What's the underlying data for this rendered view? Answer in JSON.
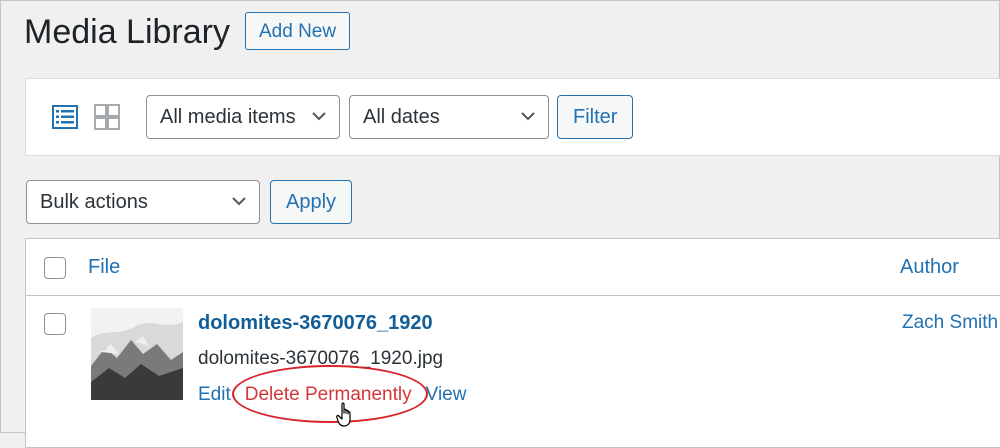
{
  "header": {
    "title": "Media Library",
    "add_new_label": "Add New"
  },
  "filter_bar": {
    "view_icons": [
      "list-view-icon",
      "grid-view-icon"
    ],
    "media_type_select": {
      "selected": "All media items"
    },
    "date_select": {
      "selected": "All dates"
    },
    "filter_label": "Filter"
  },
  "bulk": {
    "select": {
      "selected": "Bulk actions"
    },
    "apply_label": "Apply"
  },
  "table": {
    "columns": [
      "File",
      "Author"
    ],
    "rows": [
      {
        "title": "dolomites-3670076_1920",
        "filename": "dolomites-3670076_1920.jpg",
        "author": "Zach Smith",
        "actions": {
          "edit": "Edit",
          "delete": "Delete Permanently",
          "view": "View"
        }
      }
    ]
  },
  "colors": {
    "accent": "#2271b1",
    "link_dark": "#135e96",
    "delete": "#d63638",
    "highlight": "#d8232a",
    "background": "#f0f0f1"
  }
}
